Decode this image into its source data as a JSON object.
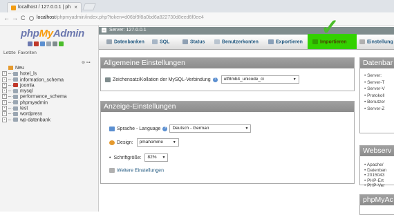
{
  "browser": {
    "tab_title": "localhost / 127.0.0.1 | ph",
    "tab_close": "×",
    "nav_back": "←",
    "nav_forward": "→",
    "nav_reload": "C",
    "url_host": "localhost",
    "url_path": "/phpmyadmin/index.php?token=d06bf9f8a0bd6a822730d8eed6f0ee4"
  },
  "logo": {
    "php": "php",
    "my": "My",
    "admin": "Admin"
  },
  "nav": {
    "recent_label": "Letzte",
    "favorites_label": "Favoriten",
    "collapse": "⊖ ⊶",
    "new_label": "Neu",
    "databases": [
      "hotel_ls",
      "information_schema",
      "joomla",
      "mysql",
      "performance_schema",
      "phpmyadmin",
      "test",
      "wordpress",
      "wp-datenbank"
    ]
  },
  "serverbar": {
    "minus": "–",
    "label": "Server: 127.0.0.1"
  },
  "menu": {
    "databases": "Datenbanken",
    "sql": "SQL",
    "status": "Status",
    "accounts": "Benutzerkonten",
    "export": "Exportieren",
    "import": "Importieren",
    "settings": "Einstellung"
  },
  "general": {
    "title": "Allgemeine Einstellungen",
    "collation_label": "Zeichensatz/Kollation der MySQL-Verbindung",
    "collation_value": "utf8mb4_unicode_ci"
  },
  "display": {
    "title": "Anzeige-Einstellungen",
    "language_label": "Sprache - Language",
    "language_value": "Deutsch - German",
    "design_label": "Design:",
    "design_value": "pmahomme",
    "fontsize_label": "Schriftgröße:",
    "fontsize_value": "82%",
    "more_settings": "Weitere Einstellungen"
  },
  "right": {
    "db_title": "Datenbar",
    "db_items": [
      "Server: ",
      "Server-T",
      "Server-V",
      "Protokoll",
      "Benutzer",
      "Server-Z"
    ],
    "web_title": "Webserv",
    "web_items": [
      "Apache/",
      "Datenban",
      "2015043",
      "PHP-Ert",
      "PHP-Ver"
    ],
    "pma_title": "phpMyAc"
  },
  "colors": {
    "highlight": "#33d100",
    "checkmark": "#4bbd2b",
    "link": "#235a81"
  }
}
